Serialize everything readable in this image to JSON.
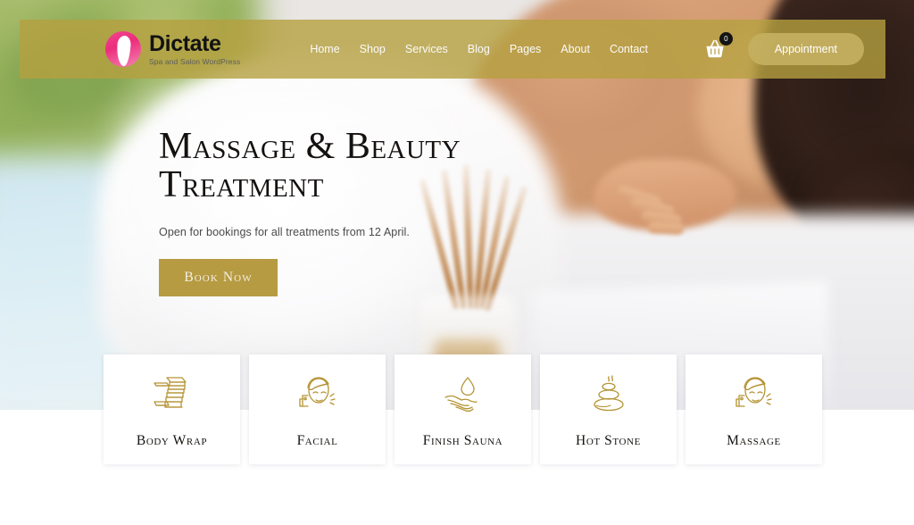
{
  "brand": {
    "name": "Dictate",
    "tagline": "Spa and Salon WordPress",
    "logo_icon": "swan-logo-icon",
    "accent_pink": "#ec2d7d"
  },
  "header": {
    "bar_color": "#b5a040",
    "nav": [
      {
        "label": "Home",
        "name": "nav-item-home"
      },
      {
        "label": "Shop",
        "name": "nav-item-shop"
      },
      {
        "label": "Services",
        "name": "nav-item-services"
      },
      {
        "label": "Blog",
        "name": "nav-item-blog"
      },
      {
        "label": "Pages",
        "name": "nav-item-pages"
      },
      {
        "label": "About",
        "name": "nav-item-about"
      },
      {
        "label": "Contact",
        "name": "nav-item-contact"
      }
    ],
    "cart": {
      "icon": "shopping-basket-icon",
      "count": "0"
    },
    "appointment_label": "Appointment",
    "appointment_color": "#c4b061"
  },
  "hero": {
    "title_line1": "Massage & Beauty",
    "title_line2": "Treatment",
    "subtitle": "Open for bookings for all treatments from 12 April.",
    "cta_label": "Book Now",
    "cta_color": "#b69b43"
  },
  "services": [
    {
      "label": "Body Wrap",
      "icon": "body-wrap-icon"
    },
    {
      "label": "Facial",
      "icon": "facial-face-towel-icon"
    },
    {
      "label": "Finish Sauna",
      "icon": "hand-water-drop-icon"
    },
    {
      "label": "Hot Stone",
      "icon": "stacked-hot-stones-icon"
    },
    {
      "label": "Massage",
      "icon": "massage-face-towel-icon"
    }
  ],
  "icon_color": "#b59334"
}
